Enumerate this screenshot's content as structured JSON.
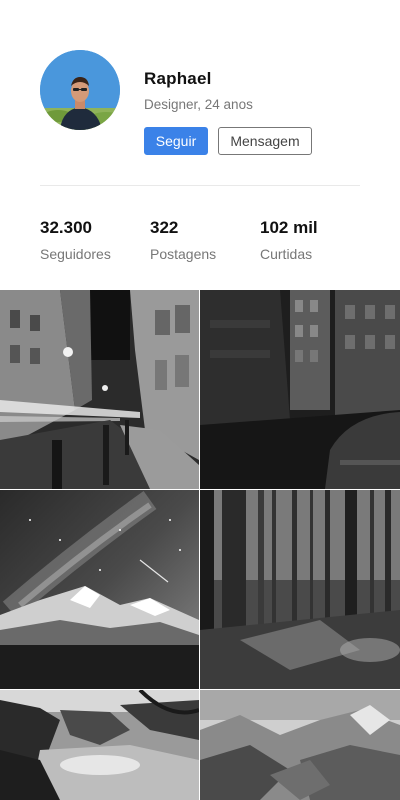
{
  "profile": {
    "name": "Raphael",
    "subtitle": "Designer, 24 anos",
    "follow_label": "Seguir",
    "message_label": "Mensagem"
  },
  "stats": [
    {
      "value": "32.300",
      "label": "Seguidores"
    },
    {
      "value": "322",
      "label": "Postagens"
    },
    {
      "value": "102 mil",
      "label": "Curtidas"
    }
  ],
  "colors": {
    "accent": "#3b82e8",
    "muted_text": "#777777"
  }
}
